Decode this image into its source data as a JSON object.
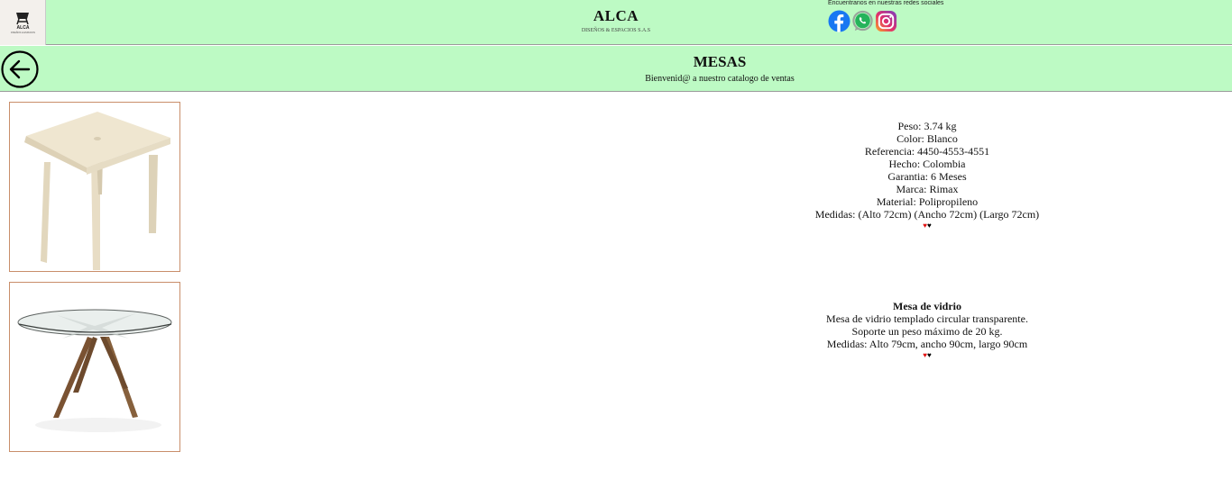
{
  "header": {
    "logo_text": "ALCA",
    "logo_sub": "DISEÑOS & ESPACIOS",
    "brand_title": "ALCA",
    "brand_subtitle": "DISEÑOS & ESPACIOS S.A.S",
    "social_label": "Encuentranos en nuestras redes sociales",
    "social_icons": [
      "facebook-icon",
      "whatsapp-icon",
      "instagram-icon"
    ]
  },
  "subheader": {
    "title": "MESAS",
    "subtitle": "Bienvenid@ a nuestro catalogo de ventas"
  },
  "products": [
    {
      "lines": [
        "Peso: 3.74 kg",
        "Color: Blanco",
        "Referencia: 4450-4553-4551",
        "Hecho: Colombia",
        "Garantia: 6 Meses",
        "Marca: Rimax",
        "Material: Polipropileno",
        "Medidas: (Alto 72cm) (Ancho 72cm) (Largo 72cm)"
      ],
      "heart_red": "♥",
      "heart_black": "♥"
    },
    {
      "name": "Mesa de vidrio",
      "lines": [
        "Mesa de vidrio templado circular transparente.",
        "Soporte un peso máximo de 20 kg.",
        "Medidas: Alto 79cm, ancho 90cm, largo 90cm"
      ],
      "heart_red": "♥",
      "heart_black": "♥"
    }
  ],
  "colors": {
    "header_bg": "#bdfac4",
    "image_border": "#c98e6a",
    "heart_red": "#e01010"
  }
}
